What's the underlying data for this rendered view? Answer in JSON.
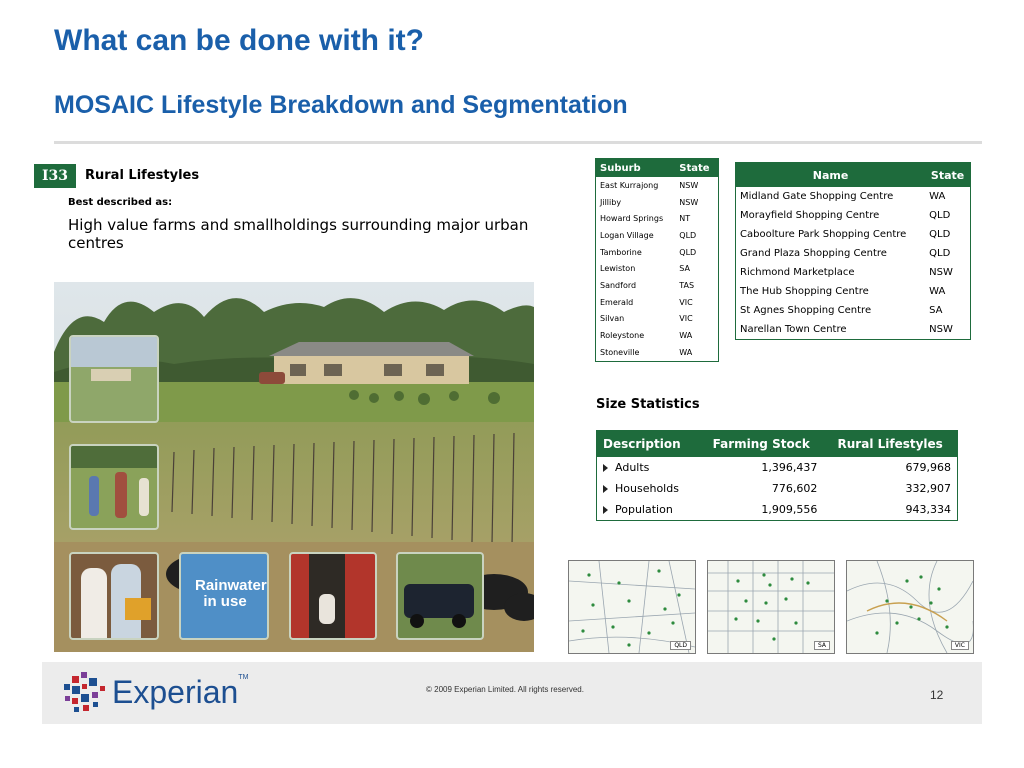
{
  "header": {
    "title": "What can be done with it?",
    "subtitle": "MOSAIC Lifestyle Breakdown and Segmentation"
  },
  "segment": {
    "code": "I33",
    "name": "Rural Lifestyles",
    "best_described_label": "Best described as:",
    "description": "High value farms and smallholdings surrounding major urban centres"
  },
  "photo": {
    "sign_text": "Rainwater in use"
  },
  "suburb_table": {
    "headers": [
      "Suburb",
      "State"
    ],
    "rows": [
      [
        "East Kurrajong",
        "NSW"
      ],
      [
        "Jilliby",
        "NSW"
      ],
      [
        "Howard Springs",
        "NT"
      ],
      [
        "Logan Village",
        "QLD"
      ],
      [
        "Tamborine",
        "QLD"
      ],
      [
        "Lewiston",
        "SA"
      ],
      [
        "Sandford",
        "TAS"
      ],
      [
        "Emerald",
        "VIC"
      ],
      [
        "Silvan",
        "VIC"
      ],
      [
        "Roleystone",
        "WA"
      ],
      [
        "Stoneville",
        "WA"
      ]
    ]
  },
  "centre_table": {
    "headers": [
      "Name",
      "State"
    ],
    "rows": [
      [
        "Midland Gate Shopping Centre",
        "WA"
      ],
      [
        "Morayfield Shopping Centre",
        "QLD"
      ],
      [
        "Caboolture Park Shopping Centre",
        "QLD"
      ],
      [
        "Grand Plaza Shopping Centre",
        "QLD"
      ],
      [
        "Richmond Marketplace",
        "NSW"
      ],
      [
        "The Hub Shopping Centre",
        "WA"
      ],
      [
        "St Agnes Shopping Centre",
        "SA"
      ],
      [
        "Narellan Town Centre",
        "NSW"
      ]
    ]
  },
  "size_stats": {
    "title": "Size Statistics",
    "headers": [
      "Description",
      "Farming Stock",
      "Rural Lifestyles"
    ],
    "rows": [
      [
        "Adults",
        "1,396,437",
        "679,968"
      ],
      [
        "Households",
        "776,602",
        "332,907"
      ],
      [
        "Population",
        "1,909,556",
        "943,334"
      ]
    ]
  },
  "maps": [
    {
      "state": "QLD"
    },
    {
      "state": "SA"
    },
    {
      "state": "VIC"
    }
  ],
  "footer": {
    "logo_text": "Experian",
    "logo_tm": "TM",
    "copyright": "© 2009 Experian Limited.  All rights reserved.",
    "page_number": "12"
  },
  "colors": {
    "title_blue": "#1a5faa",
    "table_green": "#1e6b3c",
    "logo_blue": "#1d4f91"
  }
}
